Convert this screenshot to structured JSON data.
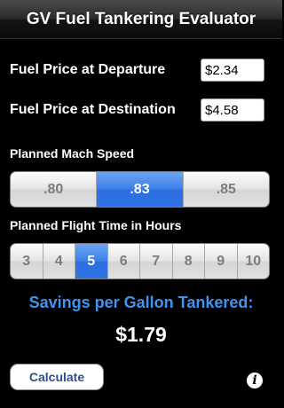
{
  "header": {
    "title": "GV Fuel Tankering Evaluator"
  },
  "fields": {
    "departure": {
      "label": "Fuel Price at Departure",
      "value": "$2.34"
    },
    "destination": {
      "label": "Fuel Price at Destination",
      "value": "$4.58"
    }
  },
  "mach": {
    "label": "Planned Mach Speed",
    "options": [
      ".80",
      ".83",
      ".85"
    ],
    "selected_index": 1
  },
  "flight_time": {
    "label": "Planned Flight Time in Hours",
    "options": [
      "3",
      "4",
      "5",
      "6",
      "7",
      "8",
      "9",
      "10"
    ],
    "selected_index": 2
  },
  "results": {
    "savings_label": "Savings per Gallon Tankered:",
    "savings_value": "$1.79"
  },
  "actions": {
    "calculate_label": "Calculate",
    "info_icon": "i"
  },
  "colors": {
    "accent": "#3e94f0",
    "selected_segment": "#2f74e4",
    "background": "#000000"
  }
}
